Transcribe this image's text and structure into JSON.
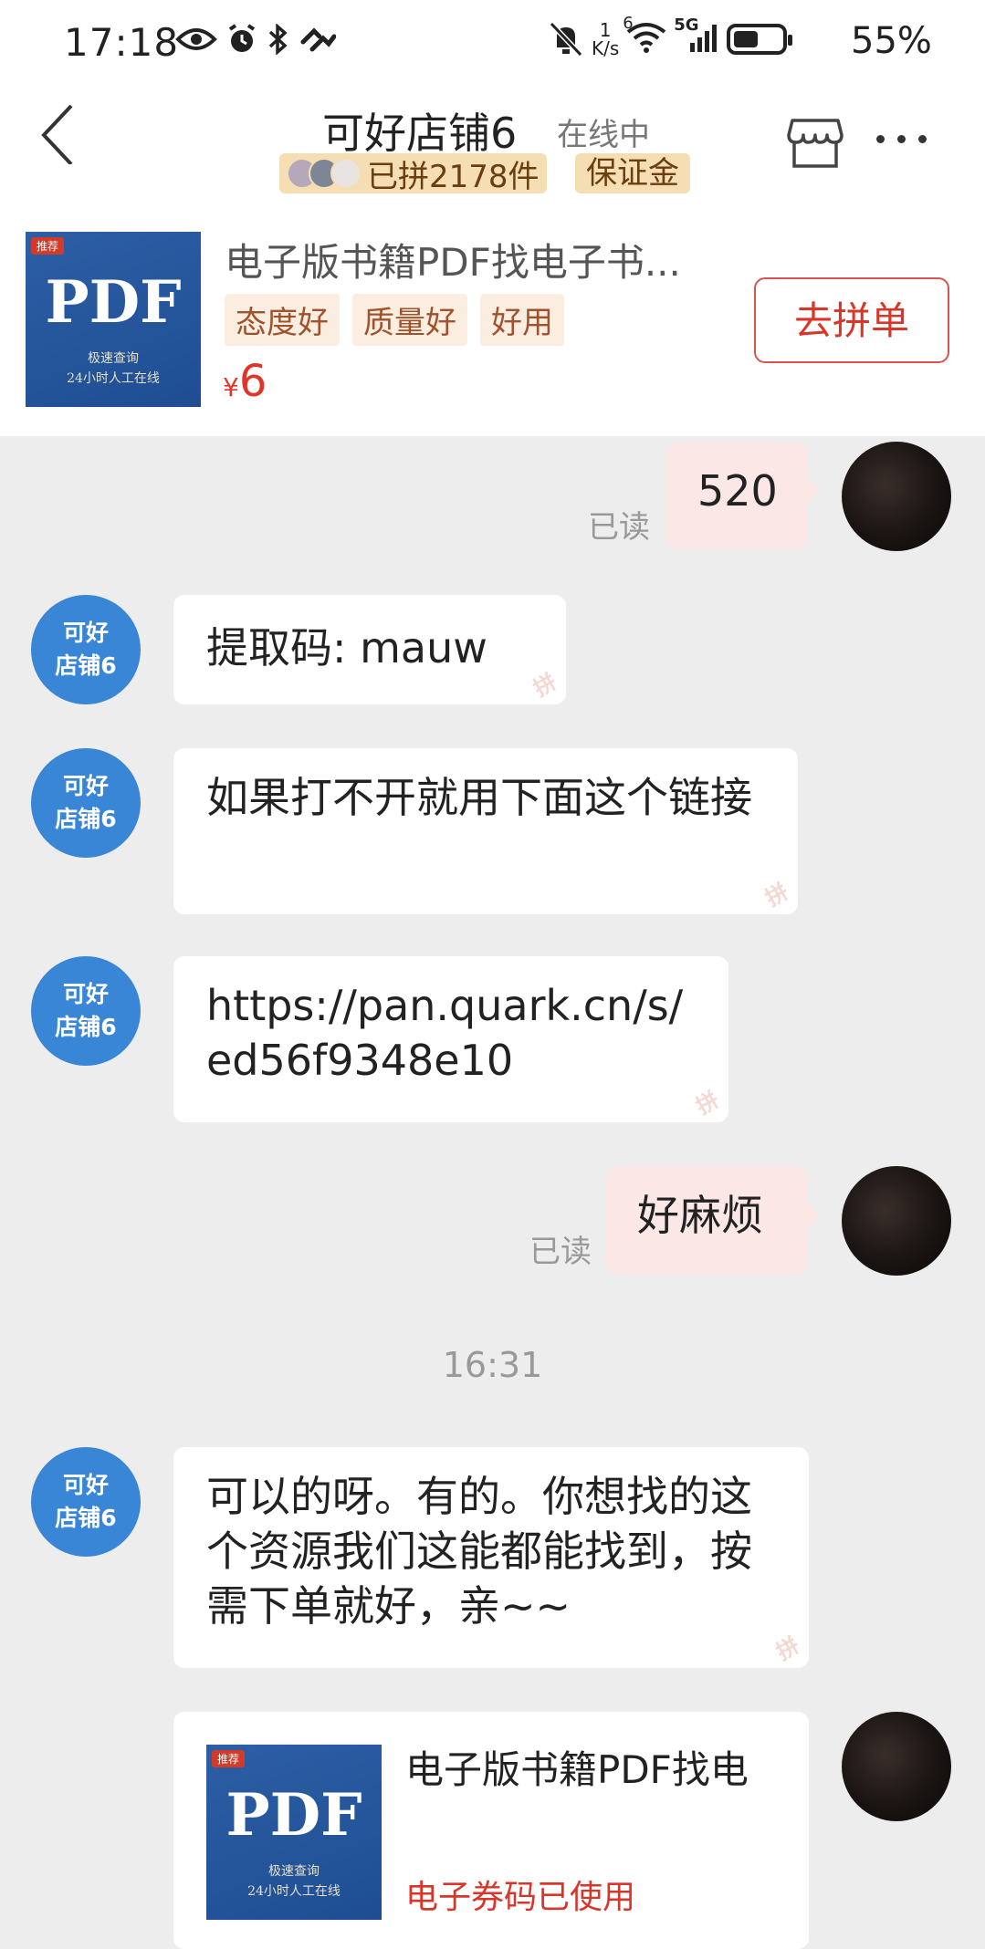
{
  "status_bar": {
    "time": "17:18",
    "network_speed_top": "1",
    "network_speed_bottom": "K/s",
    "signal_label": "5G",
    "wifi_label": "6",
    "battery": "55%"
  },
  "header": {
    "shop_name": "可好店铺6",
    "online_status": "在线中",
    "joined_count": "已拼2178件",
    "deposit_badge": "保证金"
  },
  "product": {
    "title": "电子版书籍PDF找电子书...",
    "tags": [
      "态度好",
      "质量好",
      "好用"
    ],
    "price_symbol": "¥",
    "price": "6",
    "join_button": "去拼单",
    "thumb_tag": "推荐",
    "thumb_main": "PDF",
    "thumb_sub1": "极速查询",
    "thumb_sub2": "24小时人工在线"
  },
  "shop_avatar": {
    "line1": "可好",
    "line2": "店铺6"
  },
  "messages": [
    {
      "side": "out",
      "text": "520",
      "read": "已读"
    },
    {
      "side": "in",
      "text": "提取码: mauw"
    },
    {
      "side": "in",
      "text": "如果打不开就用下面这个链接"
    },
    {
      "side": "in",
      "text": "https://pan.quark.cn/s/ed56f9348e10"
    },
    {
      "side": "out",
      "text": "好麻烦",
      "read": "已读"
    },
    {
      "side": "in",
      "text": "可以的呀。有的。你想找的这个资源我们这能都能找到，按需下单就好，亲~~"
    }
  ],
  "time_divider": "16:31",
  "product_message": {
    "title": "电子版书籍PDF找电",
    "status": "电子券码已使用"
  },
  "watermark_char": "拼",
  "colors": {
    "accent_red": "#d9362a",
    "shop_avatar_blue": "#3a86d6",
    "out_bubble": "#fbe8e6",
    "badge_bg": "#f5deb3"
  }
}
